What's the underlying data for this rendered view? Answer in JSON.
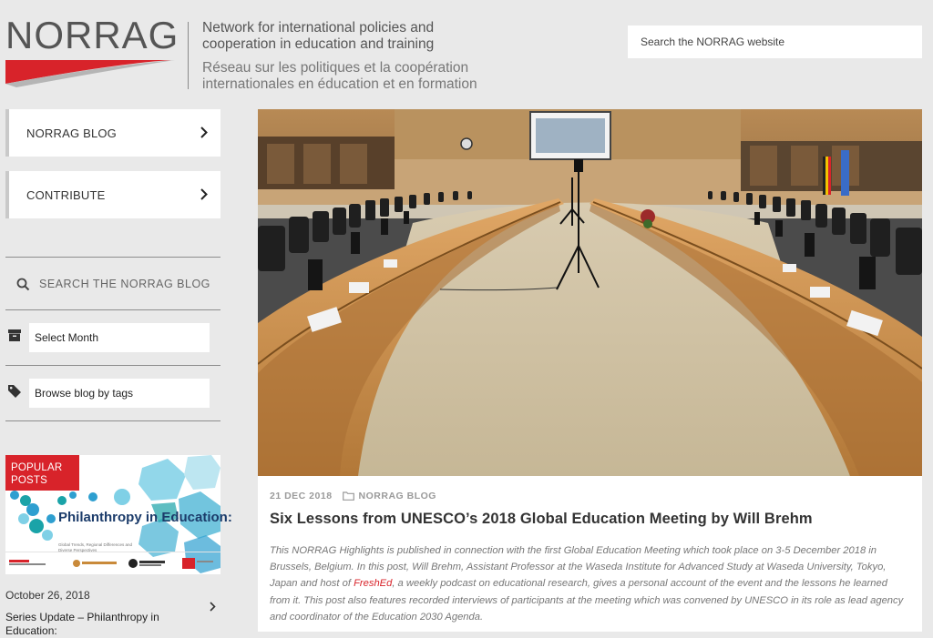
{
  "header": {
    "logo_text": "NORRAG",
    "tagline_en": "Network for international policies and cooperation in education and training",
    "tagline_fr": "Réseau sur les politiques et la coopération internationales en éducation et en formation",
    "search_placeholder": "Search the NORRAG website"
  },
  "sidebar": {
    "nav": [
      {
        "label": "NORRAG BLOG"
      },
      {
        "label": "CONTRIBUTE"
      }
    ],
    "blog_search_placeholder": "SEARCH THE NORRAG BLOG",
    "archive_select": "Select Month",
    "tags_select": "Browse blog by tags",
    "popular": {
      "badge": "POPULAR POSTS",
      "image_title": "Philanthropy in Education:",
      "image_subtitle": "Global Trends, Regional Differences and Diverse Perspectives",
      "date": "October 26, 2018",
      "title": "Series Update – Philanthropy in Education:"
    }
  },
  "article": {
    "date": "21 DEC 2018",
    "category": "NORRAG BLOG",
    "title": "Six Lessons from UNESCO’s 2018 Global Education Meeting by Will Brehm",
    "excerpt_before": "This NORRAG Highlights is published in connection with the first Global Education Meeting which took place on 3-5 December 2018 in Brussels, Belgium. In this post, Will Brehm, Assistant Professor at the Waseda Institute for Advanced Study at Waseda University, Tokyo, Japan and host of ",
    "excerpt_link": "FreshEd",
    "excerpt_after": ", a weekly podcast on educational research, gives a personal account of the event and the lessons he learned from it. This post also features recorded interviews of participants at the meeting which was convened by UNESCO in its role as lead agency and coordinator of the Education 2030 Agenda."
  },
  "colors": {
    "brand_red": "#d8232a",
    "background": "#e9e9e9",
    "philanthropy_blue": "#1b3b6a"
  }
}
